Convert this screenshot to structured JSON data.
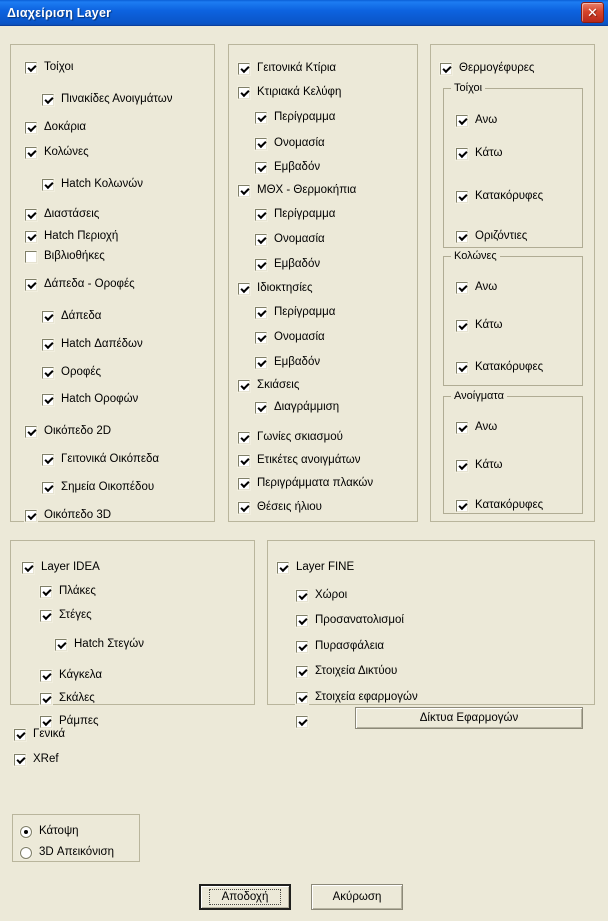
{
  "window": {
    "title": "Διαχείριση Layer",
    "close_icon": "close-icon",
    "close_glyph": "✕",
    "accent_color": "#0d63e0",
    "face_color": "#ece9d8"
  },
  "panel_walls": {
    "items": [
      {
        "label": "Τοίχοι",
        "checked": true,
        "indent": 0
      },
      {
        "label": "Πινακίδες Ανοιγμάτων",
        "checked": true,
        "indent": 1
      },
      {
        "label": "Δοκάρια",
        "checked": true,
        "indent": 0
      },
      {
        "label": "Κολώνες",
        "checked": true,
        "indent": 0
      },
      {
        "label": "Hatch Κολωνών",
        "checked": true,
        "indent": 1
      },
      {
        "label": "Διαστάσεις",
        "checked": true,
        "indent": 0
      },
      {
        "label": "Hatch Περιοχή",
        "checked": true,
        "indent": 0
      },
      {
        "label": "Βιβλιοθήκες",
        "checked": false,
        "indent": 0
      },
      {
        "label": "Δάπεδα - Οροφές",
        "checked": true,
        "indent": 0
      },
      {
        "label": "Δάπεδα",
        "checked": true,
        "indent": 1
      },
      {
        "label": "Hatch Δαπέδων",
        "checked": true,
        "indent": 1
      },
      {
        "label": "Οροφές",
        "checked": true,
        "indent": 1
      },
      {
        "label": "Hatch Οροφών",
        "checked": true,
        "indent": 1
      },
      {
        "label": "Οικόπεδο 2D",
        "checked": true,
        "indent": 0
      },
      {
        "label": "Γειτονικά Οικόπεδα",
        "checked": true,
        "indent": 1
      },
      {
        "label": "Σημεία Οικοπέδου",
        "checked": true,
        "indent": 1
      },
      {
        "label": "Οικόπεδο 3D",
        "checked": true,
        "indent": 0
      }
    ]
  },
  "panel_buildings": {
    "items": [
      {
        "label": "Γειτονικά Κτίρια",
        "checked": true,
        "indent": 0
      },
      {
        "label": "Κτιριακά Κελύφη",
        "checked": true,
        "indent": 0
      },
      {
        "label": "Περίγραμμα",
        "checked": true,
        "indent": 1
      },
      {
        "label": "Ονομασία",
        "checked": true,
        "indent": 1
      },
      {
        "label": "Εμβαδόν",
        "checked": true,
        "indent": 1
      },
      {
        "label": "ΜΘΧ - Θερμοκήπια",
        "checked": true,
        "indent": 0
      },
      {
        "label": "Περίγραμμα",
        "checked": true,
        "indent": 1
      },
      {
        "label": "Ονομασία",
        "checked": true,
        "indent": 1
      },
      {
        "label": "Εμβαδόν",
        "checked": true,
        "indent": 1
      },
      {
        "label": "Ιδιοκτησίες",
        "checked": true,
        "indent": 0
      },
      {
        "label": "Περίγραμμα",
        "checked": true,
        "indent": 1
      },
      {
        "label": "Ονομασία",
        "checked": true,
        "indent": 1
      },
      {
        "label": "Εμβαδόν",
        "checked": true,
        "indent": 1
      },
      {
        "label": "Σκιάσεις",
        "checked": true,
        "indent": 0
      },
      {
        "label": "Διαγράμμιση",
        "checked": true,
        "indent": 1
      },
      {
        "label": "Γωνίες σκιασμού",
        "checked": true,
        "indent": 0
      },
      {
        "label": "Ετικέτες ανοιγμάτων",
        "checked": true,
        "indent": 0
      },
      {
        "label": "Περιγράμματα πλακών",
        "checked": true,
        "indent": 0
      },
      {
        "label": "Θέσεις ήλιου",
        "checked": true,
        "indent": 0
      }
    ]
  },
  "panel_thermal": {
    "top_item": {
      "label": "Θερμογέφυρες",
      "checked": true
    },
    "groups": [
      {
        "legend": "Τοίχοι",
        "items": [
          {
            "label": "Ανω",
            "checked": true
          },
          {
            "label": "Κάτω",
            "checked": true
          },
          {
            "label": "Κατακόρυφες",
            "checked": true
          },
          {
            "label": "Οριζόντιες",
            "checked": true
          }
        ]
      },
      {
        "legend": "Κολώνες",
        "items": [
          {
            "label": "Ανω",
            "checked": true
          },
          {
            "label": "Κάτω",
            "checked": true
          },
          {
            "label": "Κατακόρυφες",
            "checked": true
          }
        ]
      },
      {
        "legend": "Ανοίγματα",
        "items": [
          {
            "label": "Ανω",
            "checked": true
          },
          {
            "label": "Κάτω",
            "checked": true
          },
          {
            "label": "Κατακόρυφες",
            "checked": true
          }
        ]
      }
    ]
  },
  "panel_idea": {
    "items": [
      {
        "label": "Layer IDEA",
        "checked": true,
        "indent": 0
      },
      {
        "label": "Πλάκες",
        "checked": true,
        "indent": 1
      },
      {
        "label": "Στέγες",
        "checked": true,
        "indent": 1
      },
      {
        "label": "Hatch Στεγών",
        "checked": true,
        "indent": 2
      },
      {
        "label": "Κάγκελα",
        "checked": true,
        "indent": 1
      },
      {
        "label": "Σκάλες",
        "checked": true,
        "indent": 1
      },
      {
        "label": "Ράμπες",
        "checked": true,
        "indent": 1
      }
    ]
  },
  "panel_fine": {
    "items": [
      {
        "label": "Layer FINE",
        "checked": true,
        "indent": 0
      },
      {
        "label": "Χώροι",
        "checked": true,
        "indent": 1
      },
      {
        "label": "Προσανατολισμοί",
        "checked": true,
        "indent": 1
      },
      {
        "label": "Πυρασφάλεια",
        "checked": true,
        "indent": 1
      },
      {
        "label": "Στοιχεία Δικτύου",
        "checked": true,
        "indent": 1
      },
      {
        "label": "Στοιχεία εφαρμογών",
        "checked": true,
        "indent": 1
      },
      {
        "label": "",
        "checked": true,
        "indent": 1
      }
    ],
    "networks_button": "Δίκτυα Εφαρμογών"
  },
  "global_options": [
    {
      "label": "Γενικά",
      "checked": true
    },
    {
      "label": "XRef",
      "checked": true
    }
  ],
  "view_mode": {
    "options": [
      {
        "label": "Κάτοψη",
        "selected": true
      },
      {
        "label": "3D Απεικόνιση",
        "selected": false
      }
    ]
  },
  "footer": {
    "accept_label": "Αποδοχή",
    "cancel_label": "Ακύρωση"
  }
}
